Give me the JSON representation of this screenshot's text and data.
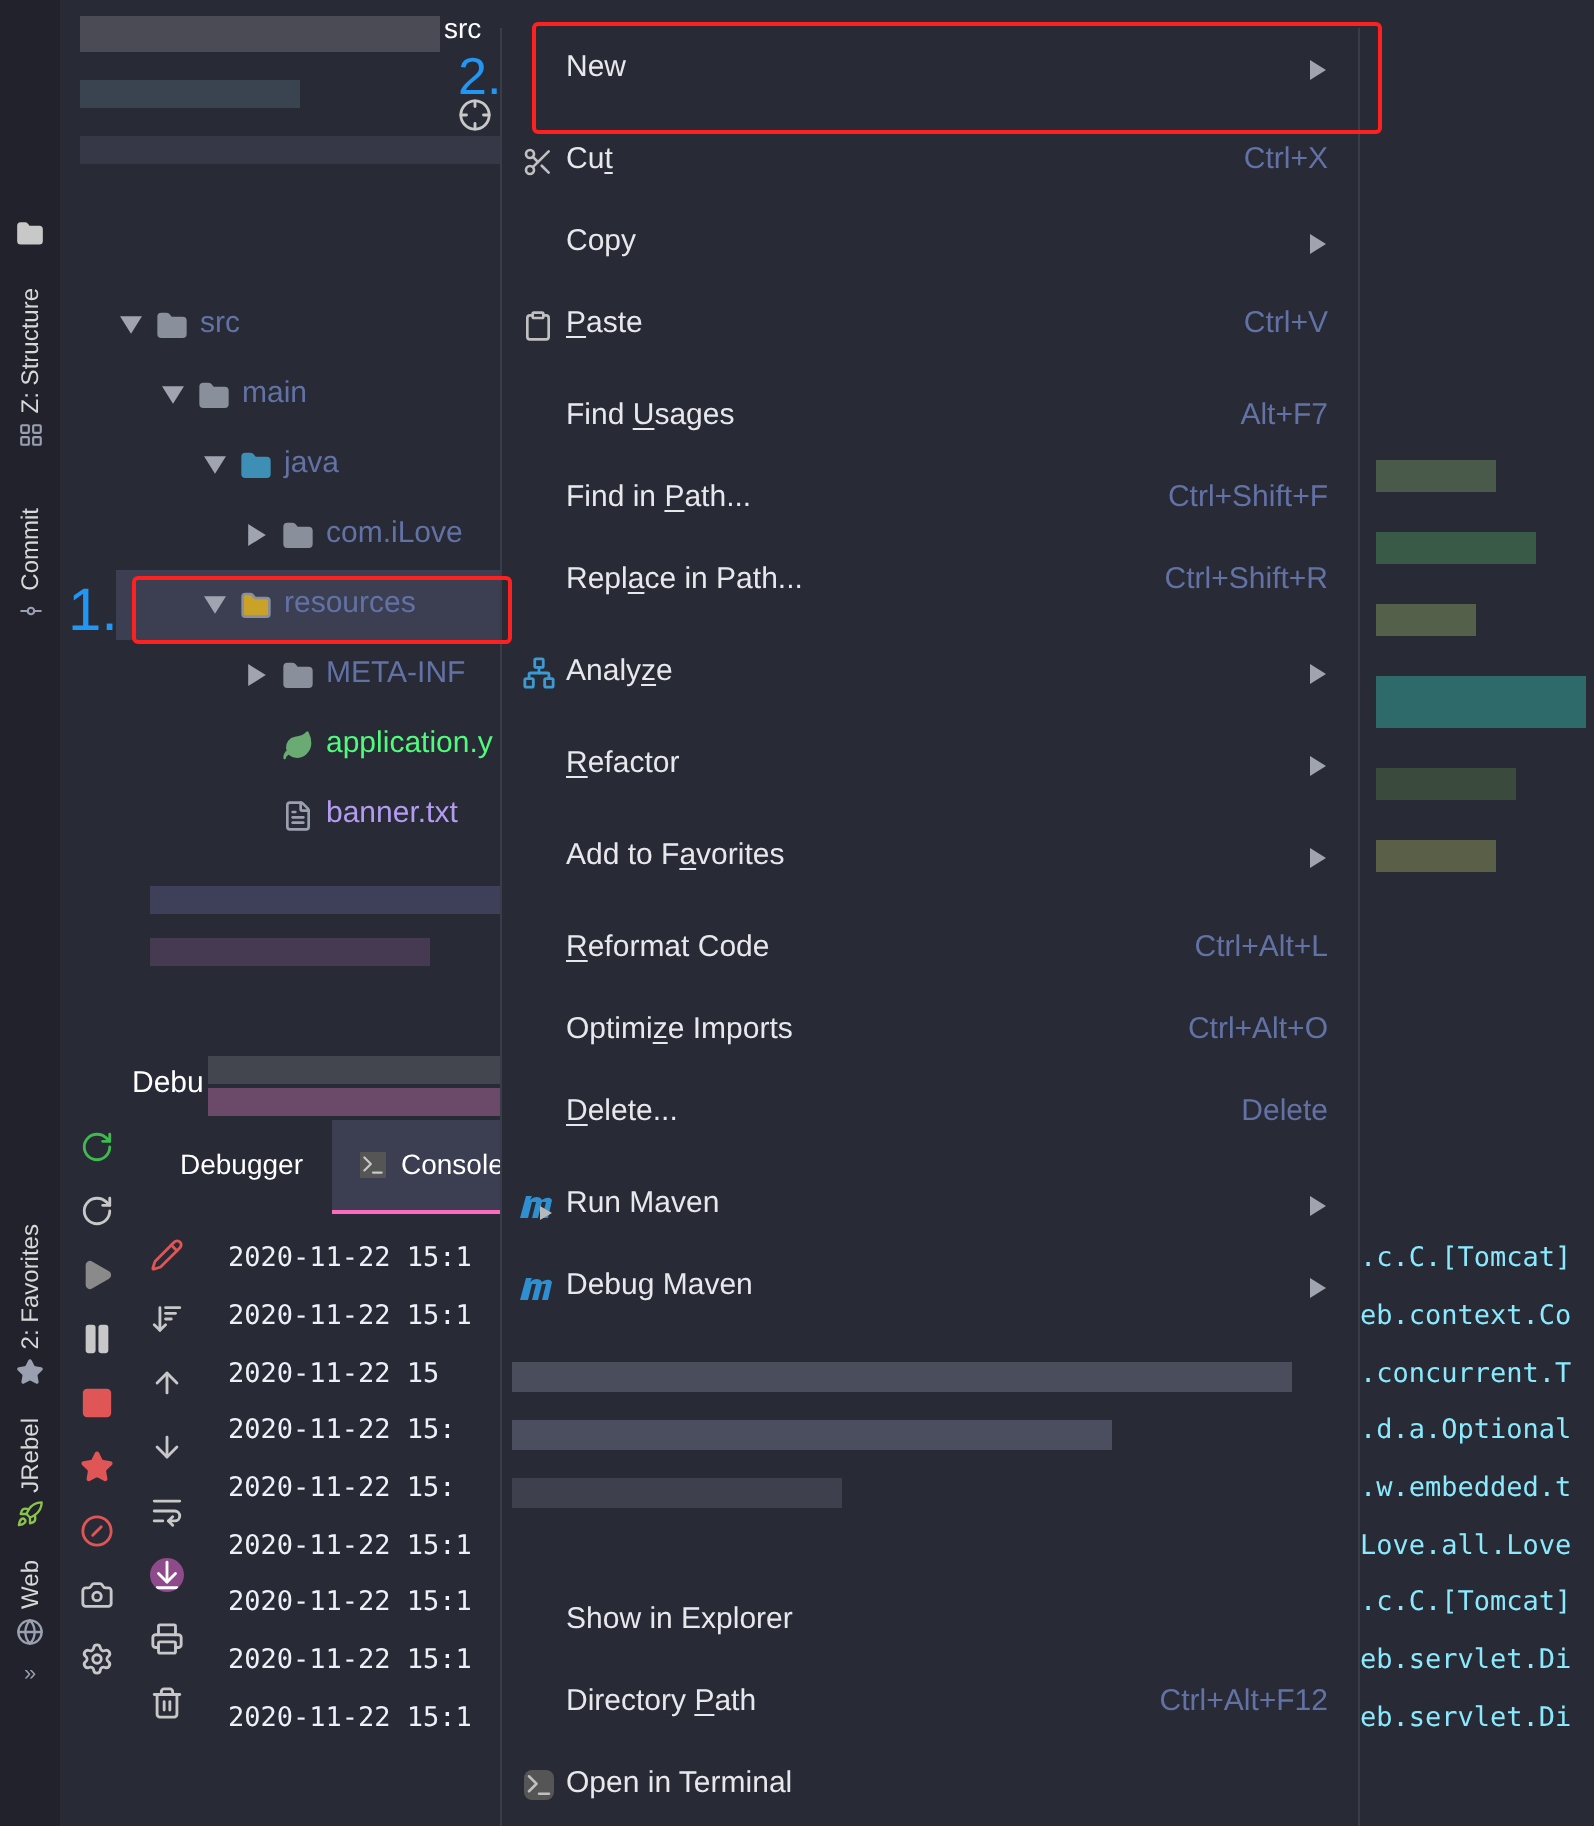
{
  "top_bar": {
    "title": "src"
  },
  "annotations": [
    {
      "label": "1."
    },
    {
      "label": "2."
    }
  ],
  "side_tabs": [
    {
      "label": "Z: Structure",
      "kind": "structure"
    },
    {
      "label": "Commit",
      "kind": "commit"
    },
    {
      "label": "2: Favorites",
      "kind": "favorites"
    },
    {
      "label": "JRebel",
      "kind": "jrebel"
    },
    {
      "label": "Web",
      "kind": "web"
    }
  ],
  "side_more": "»",
  "tree": [
    {
      "label": "src",
      "kind": "folder",
      "expanded": true,
      "selected": false,
      "children": [
        {
          "label": "main",
          "kind": "folder",
          "expanded": true,
          "selected": false,
          "children": [
            {
              "label": "java",
              "kind": "source-folder",
              "expanded": true,
              "selected": false,
              "children": [
                {
                  "label": "com.iLove",
                  "kind": "package",
                  "expanded": false,
                  "selected": false
                }
              ]
            },
            {
              "label": "resources",
              "kind": "resource-folder",
              "expanded": true,
              "selected": true,
              "children": [
                {
                  "label": "META-INF",
                  "kind": "folder",
                  "expanded": false,
                  "selected": false
                },
                {
                  "label": "application.y",
                  "kind": "spring-config",
                  "selected": false
                },
                {
                  "label": "banner.txt",
                  "kind": "text-file",
                  "selected": false
                }
              ]
            }
          ]
        }
      ]
    }
  ],
  "debug": {
    "title": "Debu",
    "tabs": [
      {
        "label": "Debugger",
        "selected": false
      },
      {
        "label": "Console",
        "selected": true
      }
    ],
    "console_lines": [
      {
        "start": "2020-11-22 15:1",
        "end": ".c.C.[Tomcat]"
      },
      {
        "start": "2020-11-22 15:1",
        "end": "eb.context.Co"
      },
      {
        "start": "2020-11-22 15",
        "end": ".concurrent.T"
      },
      {
        "start": "2020-11-22 15:",
        "end": ".d.a.Optional"
      },
      {
        "start": "2020-11-22 15:",
        "end": ".w.embedded.t"
      },
      {
        "start": "2020-11-22 15:1",
        "end": "Love.all.Love"
      },
      {
        "start": "2020-11-22 15:1",
        "end": ".c.C.[Tomcat]"
      },
      {
        "start": "2020-11-22 15:1",
        "end": "eb.servlet.Di"
      },
      {
        "start": "2020-11-22 15:1",
        "end": "eb.servlet.Di"
      }
    ]
  },
  "context_menu": {
    "groups": [
      {
        "kind": "items",
        "items": [
          {
            "kind": "plain",
            "label": {
              "pre": "New"
            },
            "submenu": true
          }
        ]
      },
      {
        "kind": "items",
        "items": [
          {
            "kind": "cut",
            "label": {
              "pre": "Cu",
              "key": "t"
            },
            "shortcut": "Ctrl+X",
            "submenu": false
          },
          {
            "kind": "plain",
            "label": {
              "pre": "Copy"
            },
            "submenu": true
          },
          {
            "kind": "paste",
            "label": {
              "key": "P",
              "post": "aste"
            },
            "shortcut": "Ctrl+V",
            "submenu": false
          }
        ]
      },
      {
        "kind": "items",
        "items": [
          {
            "kind": "plain",
            "label": {
              "pre": "Find ",
              "key": "U",
              "post": "sages"
            },
            "shortcut": "Alt+F7",
            "submenu": false
          },
          {
            "kind": "plain",
            "label": {
              "pre": "Find in ",
              "key": "P",
              "post": "ath..."
            },
            "shortcut": "Ctrl+Shift+F",
            "submenu": false
          },
          {
            "kind": "plain",
            "label": {
              "pre": "Repl",
              "key": "a",
              "post": "ce in Path..."
            },
            "shortcut": "Ctrl+Shift+R",
            "submenu": false
          }
        ]
      },
      {
        "kind": "items",
        "items": [
          {
            "kind": "analyze",
            "label": {
              "pre": "Analy",
              "key": "z",
              "post": "e"
            },
            "submenu": true
          }
        ]
      },
      {
        "kind": "items",
        "items": [
          {
            "kind": "plain",
            "label": {
              "key": "R",
              "post": "efactor"
            },
            "submenu": true
          }
        ]
      },
      {
        "kind": "items",
        "items": [
          {
            "kind": "plain",
            "label": {
              "pre": "Add to F",
              "key": "a",
              "post": "vorites"
            },
            "submenu": true
          }
        ]
      },
      {
        "kind": "items",
        "items": [
          {
            "kind": "plain",
            "label": {
              "key": "R",
              "post": "eformat Code"
            },
            "shortcut": "Ctrl+Alt+L",
            "submenu": false
          },
          {
            "kind": "plain",
            "label": {
              "pre": "Optimi",
              "key": "z",
              "post": "e Imports"
            },
            "shortcut": "Ctrl+Alt+O",
            "submenu": false
          },
          {
            "kind": "plain",
            "label": {
              "key": "D",
              "post": "elete..."
            },
            "shortcut": "Delete",
            "submenu": false
          }
        ]
      },
      {
        "kind": "items",
        "items": [
          {
            "kind": "maven-run",
            "label": {
              "pre": "Run Maven"
            },
            "submenu": true
          },
          {
            "kind": "maven-debug",
            "label": {
              "pre": "Debug Maven"
            },
            "submenu": true
          }
        ]
      },
      {
        "kind": "pixelated"
      },
      {
        "kind": "items",
        "items": [
          {
            "kind": "plain",
            "label": {
              "pre": "Show in Explorer"
            },
            "submenu": false
          },
          {
            "kind": "plain",
            "label": {
              "pre": "Directory ",
              "key": "P",
              "post": "ath"
            },
            "shortcut": "Ctrl+Alt+F12",
            "submenu": false
          },
          {
            "kind": "terminal",
            "label": {
              "pre": "Open in Terminal"
            },
            "submenu": false
          }
        ]
      }
    ]
  }
}
